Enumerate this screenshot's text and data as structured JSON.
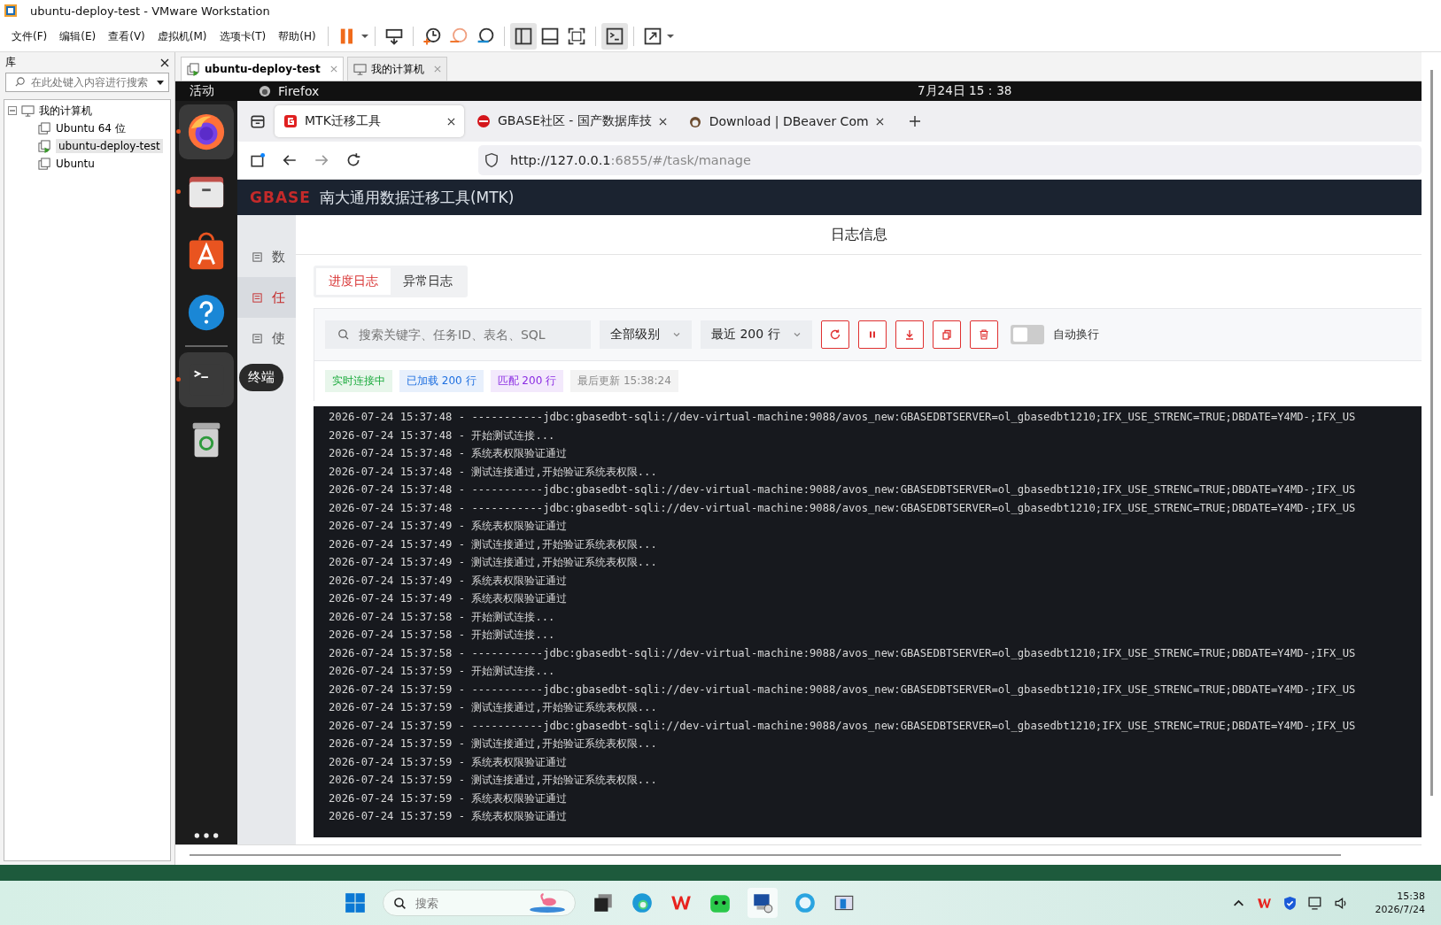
{
  "window": {
    "title": "ubuntu-deploy-test - VMware Workstation"
  },
  "menu": [
    "文件(F)",
    "编辑(E)",
    "查看(V)",
    "虚拟机(M)",
    "选项卡(T)",
    "帮助(H)"
  ],
  "library": {
    "title": "库",
    "search": {
      "placeholder": "在此处键入内容进行搜索"
    },
    "tree": [
      {
        "label": "我的计算机",
        "expanded": true,
        "children": [
          {
            "label": "Ubuntu 64 位",
            "selected": false,
            "running": false
          },
          {
            "label": "ubuntu-deploy-test",
            "selected": true,
            "running": true
          },
          {
            "label": "Ubuntu",
            "selected": false,
            "running": false
          }
        ]
      }
    ]
  },
  "vm_tabs": [
    {
      "label": "ubuntu-deploy-test",
      "selected": true
    },
    {
      "label": "我的计算机",
      "selected": false
    }
  ],
  "guest_top_bar": {
    "activities": "活动",
    "app": "Firefox",
    "clock": "7月24日  15：38"
  },
  "dock": {
    "tooltip": "终端"
  },
  "browser": {
    "tabs": [
      {
        "title": "MTK迁移工具",
        "selected": true
      },
      {
        "title": "GBASE社区 - 国产数据库技",
        "selected": false
      },
      {
        "title": "Download | DBeaver Com",
        "selected": false
      }
    ],
    "url": {
      "host": "http://127.0.0.1",
      "path": ":6855/#/task/manage"
    }
  },
  "app": {
    "logo": "GBASE",
    "title": "南大通用数据迁移工具(MTK)",
    "sidebar": [
      {
        "label": "数",
        "selected": false
      },
      {
        "label": "任",
        "selected": true
      },
      {
        "label": "使",
        "selected": false
      }
    ]
  },
  "modal": {
    "title": "日志信息",
    "tabs": [
      {
        "label": "进度日志",
        "selected": true
      },
      {
        "label": "异常日志",
        "selected": false
      }
    ],
    "search": {
      "placeholder": "搜索关键字、任务ID、表名、SQL"
    },
    "selects": [
      "全部级别",
      "最近 200 行"
    ],
    "wrap_toggle": {
      "label": "自动换行",
      "on": false
    },
    "badges": [
      {
        "text": "实时连接中",
        "color": "#1aaa3c"
      },
      {
        "text": "已加载 200 行",
        "color": "#1e6fe0"
      },
      {
        "text": "匹配 200 行",
        "color": "#8a2be2"
      },
      {
        "text": "最后更新 15:38:24",
        "color": "#8a8a8a"
      }
    ],
    "log": [
      "2026-07-24 15:37:48 - -----------jdbc:gbasedbt-sqli://dev-virtual-machine:9088/avos_new:GBASEDBTSERVER=ol_gbasedbt1210;IFX_USE_STRENC=TRUE;DBDATE=Y4MD-;IFX_US",
      "2026-07-24 15:37:48 - 开始测试连接...",
      "2026-07-24 15:37:48 - 系统表权限验证通过",
      "2026-07-24 15:37:48 - 测试连接通过,开始验证系统表权限...",
      "2026-07-24 15:37:48 - -----------jdbc:gbasedbt-sqli://dev-virtual-machine:9088/avos_new:GBASEDBTSERVER=ol_gbasedbt1210;IFX_USE_STRENC=TRUE;DBDATE=Y4MD-;IFX_US",
      "2026-07-24 15:37:48 - -----------jdbc:gbasedbt-sqli://dev-virtual-machine:9088/avos_new:GBASEDBTSERVER=ol_gbasedbt1210;IFX_USE_STRENC=TRUE;DBDATE=Y4MD-;IFX_US",
      "2026-07-24 15:37:49 - 系统表权限验证通过",
      "2026-07-24 15:37:49 - 测试连接通过,开始验证系统表权限...",
      "2026-07-24 15:37:49 - 测试连接通过,开始验证系统表权限...",
      "2026-07-24 15:37:49 - 系统表权限验证通过",
      "2026-07-24 15:37:49 - 系统表权限验证通过",
      "2026-07-24 15:37:58 - 开始测试连接...",
      "2026-07-24 15:37:58 - 开始测试连接...",
      "2026-07-24 15:37:58 - -----------jdbc:gbasedbt-sqli://dev-virtual-machine:9088/avos_new:GBASEDBTSERVER=ol_gbasedbt1210;IFX_USE_STRENC=TRUE;DBDATE=Y4MD-;IFX_US",
      "2026-07-24 15:37:59 - 开始测试连接...",
      "2026-07-24 15:37:59 - -----------jdbc:gbasedbt-sqli://dev-virtual-machine:9088/avos_new:GBASEDBTSERVER=ol_gbasedbt1210;IFX_USE_STRENC=TRUE;DBDATE=Y4MD-;IFX_US",
      "2026-07-24 15:37:59 - 测试连接通过,开始验证系统表权限...",
      "2026-07-24 15:37:59 - -----------jdbc:gbasedbt-sqli://dev-virtual-machine:9088/avos_new:GBASEDBTSERVER=ol_gbasedbt1210;IFX_USE_STRENC=TRUE;DBDATE=Y4MD-;IFX_US",
      "2026-07-24 15:37:59 - 测试连接通过,开始验证系统表权限...",
      "2026-07-24 15:37:59 - 系统表权限验证通过",
      "2026-07-24 15:37:59 - 测试连接通过,开始验证系统表权限...",
      "2026-07-24 15:37:59 - 系统表权限验证通过",
      "2026-07-24 15:37:59 - 系统表权限验证通过"
    ]
  },
  "taskbar": {
    "search": {
      "placeholder": "搜索"
    },
    "time": "15:38",
    "date": "2026/7/24"
  }
}
